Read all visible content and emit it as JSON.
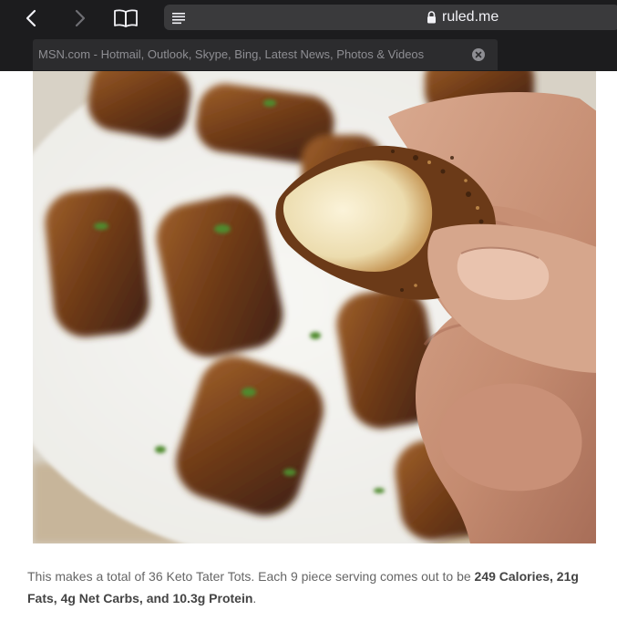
{
  "browser": {
    "url": "ruled.me",
    "tab_title": "MSN.com - Hotmail, Outlook, Skype, Bing, Latest News, Photos & Videos"
  },
  "icons": [
    "back-icon",
    "forward-icon",
    "bookmarks-icon",
    "reader-icon",
    "lock-icon",
    "close-icon"
  ],
  "article": {
    "photo_alt": "Hand holding a bitten keto tater tot over a plate of tater tots",
    "caption_part1": "This makes a total of 36 Keto Tater Tots. Each 9 piece serving comes out to be ",
    "caption_bold": "249 Calories, 21g Fats, 4g Net Carbs, and 10.3g Protein",
    "caption_end": "."
  },
  "colors": {
    "toolbar": "#1c1c1e",
    "address_bar": "#3a3a3c",
    "caption_text": "#666666"
  }
}
